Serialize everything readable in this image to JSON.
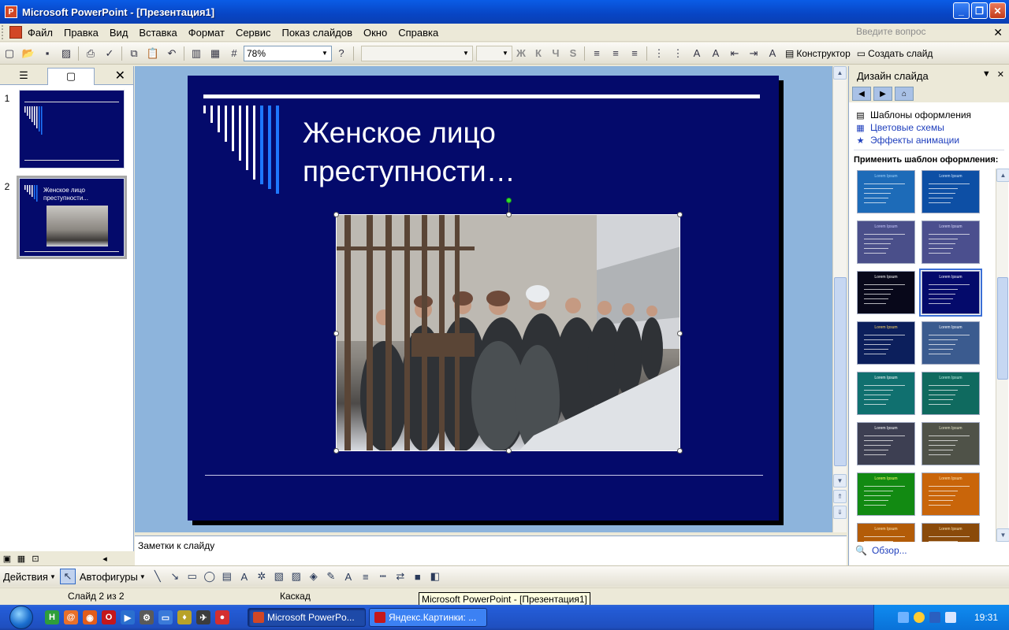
{
  "window": {
    "title": "Microsoft PowerPoint - [Презентация1]",
    "min": "_",
    "max": "❐",
    "close": "✕"
  },
  "menu": {
    "items": [
      "Файл",
      "Правка",
      "Вид",
      "Вставка",
      "Формат",
      "Сервис",
      "Показ слайдов",
      "Окно",
      "Справка"
    ],
    "ask_placeholder": "Введите вопрос",
    "close": "✕"
  },
  "toolbar": {
    "zoom": "78%",
    "constructor_label": "Конструктор",
    "new_slide_label": "Создать слайд",
    "format_buttons": [
      "Ж",
      "К",
      "Ч",
      "S"
    ]
  },
  "left_panel": {
    "close": "✕",
    "slides": [
      {
        "number": "1",
        "title": ""
      },
      {
        "number": "2",
        "title": "Женское лицо преступности..."
      }
    ]
  },
  "slide": {
    "title_line1": "Женское лицо",
    "title_line2": "преступности…"
  },
  "notes": {
    "placeholder": "Заметки к слайду"
  },
  "task_pane": {
    "title": "Дизайн слайда",
    "links": [
      {
        "label": "Шаблоны оформления",
        "icon": "templates-icon"
      },
      {
        "label": "Цветовые схемы",
        "icon": "color-schemes-icon"
      },
      {
        "label": "Эффекты анимации",
        "icon": "animation-effects-icon"
      }
    ],
    "apply_label": "Применить шаблон оформления:",
    "browse_label": "Обзор...",
    "template_caption": "Lorem Ipsum",
    "templates": [
      {
        "color": "#1d6bb8",
        "title_color": "#9fd4ff"
      },
      {
        "color": "#0d4fa5",
        "title_color": "#cfe6ff"
      },
      {
        "color": "#4a4f8a",
        "title_color": "#c9c9ff"
      },
      {
        "color": "#4b4f8e",
        "title_color": "#dcdcff"
      },
      {
        "color": "#08081a",
        "title_color": "#ffffff"
      },
      {
        "color": "#040a6b",
        "title_color": "#ffffff"
      },
      {
        "color": "#0c1f5c",
        "title_color": "#ffd966"
      },
      {
        "color": "#3b5b8f",
        "title_color": "#ffffff"
      },
      {
        "color": "#10706f",
        "title_color": "#ffffff"
      },
      {
        "color": "#0f6a5f",
        "title_color": "#bff0e4"
      },
      {
        "color": "#3d3f52",
        "title_color": "#ffffff"
      },
      {
        "color": "#4f5248",
        "title_color": "#e6e6c8"
      },
      {
        "color": "#128a12",
        "title_color": "#ffff66"
      },
      {
        "color": "#c9650a",
        "title_color": "#ffe6b3"
      },
      {
        "color": "#b35c08",
        "title_color": "#ffe6b3"
      },
      {
        "color": "#8a4a0a",
        "title_color": "#ffe6b3"
      }
    ]
  },
  "drawing_toolbar": {
    "actions_label": "Действия",
    "autoshapes_label": "Автофигуры"
  },
  "status": {
    "slide_info": "Слайд 2 из 2",
    "design": "Каскад",
    "tooltip": "Microsoft PowerPoint - [Презентация1]"
  },
  "taskbar": {
    "tasks": [
      {
        "label": "Microsoft PowerPo...",
        "active": true
      },
      {
        "label": "Яндекс.Картинки: ...",
        "active": false
      }
    ],
    "lang": "RU",
    "clock": "19:31"
  },
  "colors": {
    "slide_bg": "#040a6b",
    "edit_bg": "#8db4dc",
    "title_text": "#ffffff",
    "stripe_blue": "#1e78ff"
  }
}
